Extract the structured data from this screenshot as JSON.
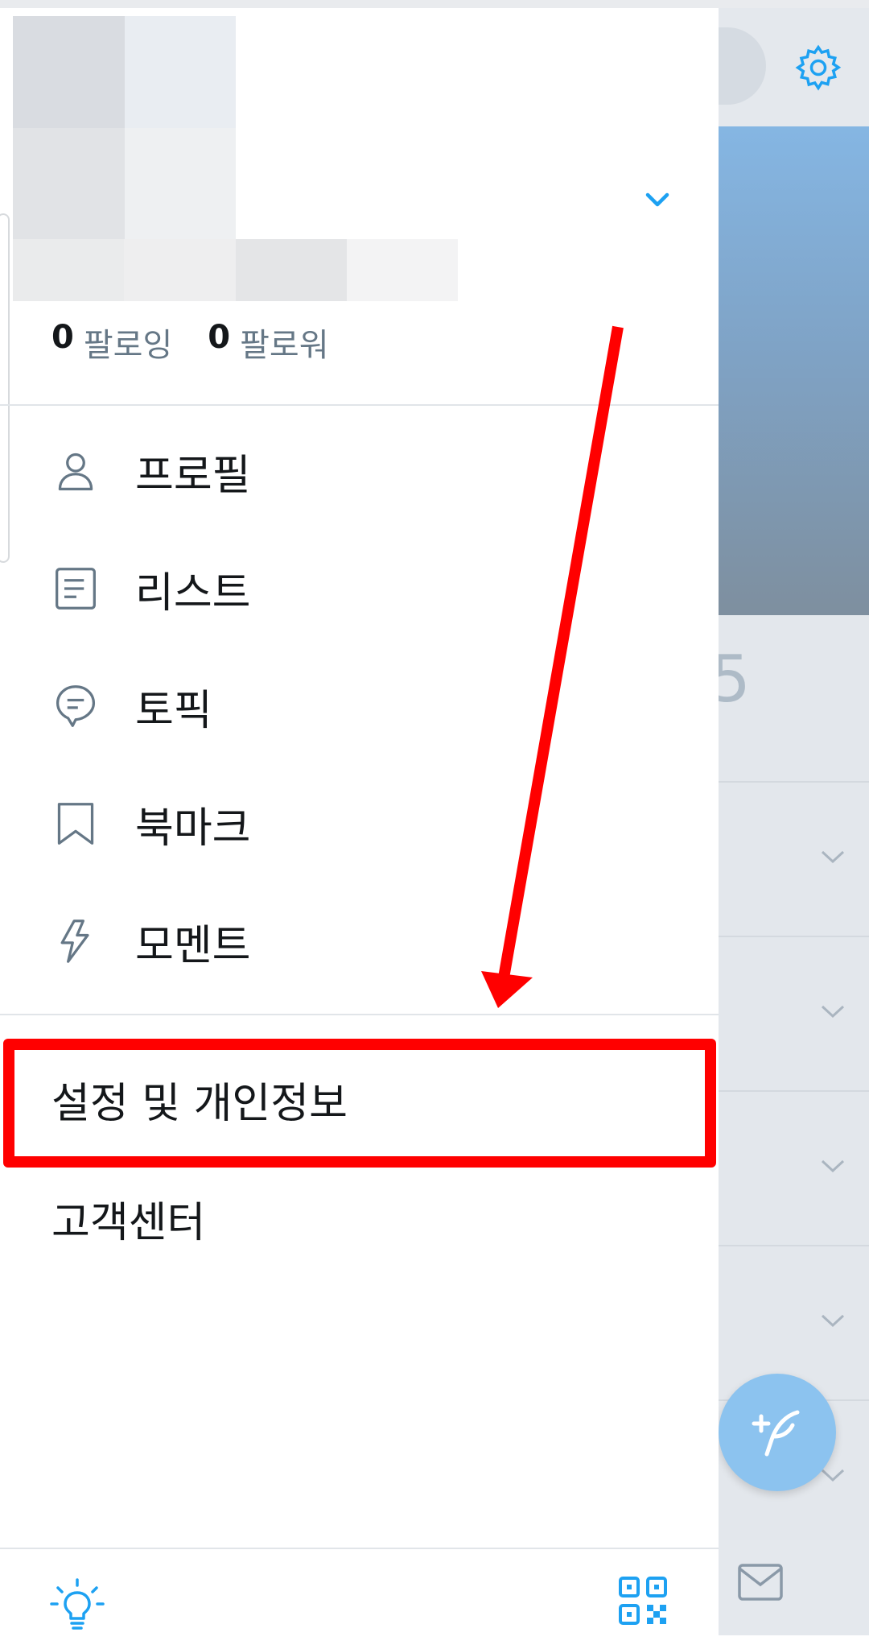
{
  "drawer": {
    "stats": {
      "following_count": "0",
      "following_label": "팔로잉",
      "followers_count": "0",
      "followers_label": "팔로워"
    },
    "menu": [
      {
        "label": "프로필",
        "icon": "person-icon"
      },
      {
        "label": "리스트",
        "icon": "list-icon"
      },
      {
        "label": "토픽",
        "icon": "topic-icon"
      },
      {
        "label": "북마크",
        "icon": "bookmark-icon"
      },
      {
        "label": "모멘트",
        "icon": "lightning-icon"
      }
    ],
    "secondary": [
      {
        "label": "설정 및 개인정보",
        "highlighted": true
      },
      {
        "label": "고객센터",
        "highlighted": false
      }
    ],
    "bottom_icons": [
      "lightbulb-icon",
      "qr-code-icon"
    ]
  },
  "background": {
    "banner_fragment": "5",
    "icons": [
      "gear-icon",
      "mail-icon",
      "compose-tweet-icon",
      "chevron-down-icon"
    ]
  },
  "annotation": {
    "color": "#ff0000",
    "accent": "#1da1f2"
  }
}
